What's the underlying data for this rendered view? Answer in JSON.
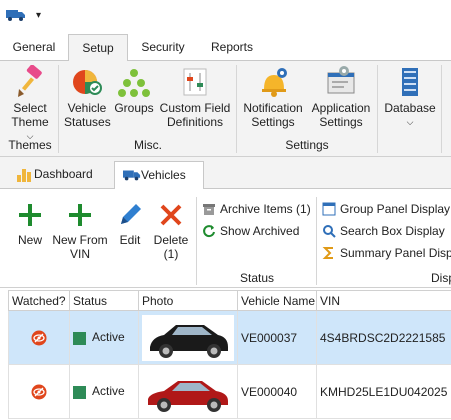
{
  "ribbon_tabs": [
    "General",
    "Setup",
    "Security",
    "Reports"
  ],
  "active_tab": "Setup",
  "ribbon": {
    "select_theme": "Select Theme",
    "vehicle_statuses": "Vehicle Statuses",
    "groups": "Groups",
    "custom_field_definitions": "Custom Field Definitions",
    "notification_settings": "Notification Settings",
    "application_settings": "Application Settings",
    "database": "Database",
    "group_themes": "Themes",
    "group_misc": "Misc.",
    "group_settings": "Settings"
  },
  "doc_tabs": [
    "Dashboard",
    "Vehicles"
  ],
  "active_doc_tab": "Vehicles",
  "toolbar": {
    "new": "New",
    "new_from_vin": "New From VIN",
    "edit": "Edit",
    "delete": "Delete (1)",
    "archive_items": "Archive Items (1)",
    "show_archived": "Show Archived",
    "status_group": "Status",
    "group_panel_display": "Group Panel Display",
    "search_box_display": "Search Box Display",
    "summary_panel_display": "Summary Panel Display",
    "display_group": "Display"
  },
  "grid": {
    "columns": [
      "Watched?",
      "Status",
      "Photo",
      "Vehicle Name",
      "VIN"
    ],
    "rows": [
      {
        "status": "Active",
        "vehicle_name": "VE000037",
        "vin": "4S4BRDSC2D2221585",
        "car_color": "#1a1a1a",
        "selected": true
      },
      {
        "status": "Active",
        "vehicle_name": "VE000040",
        "vin": "KMHD25LE1DU042025",
        "car_color": "#b01818",
        "selected": false
      }
    ]
  },
  "colors": {
    "accent_green": "#1e8b2e",
    "delete_red": "#e0461c",
    "selected_row": "#cfe6fa"
  }
}
